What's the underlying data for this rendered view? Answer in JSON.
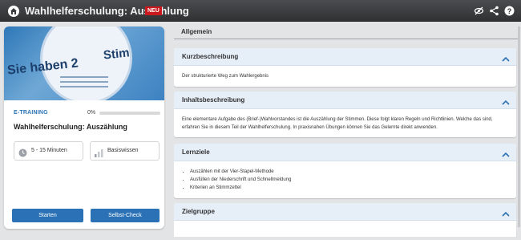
{
  "header": {
    "title": "Wahlhelferschulung: Auszählung",
    "badge": "NEU",
    "icons": [
      "home-icon",
      "eye-off-icon",
      "share-icon",
      "help-icon"
    ]
  },
  "card": {
    "hero_words": [
      "Sie haben 2",
      "Stim"
    ],
    "type_label": "E-TRAINING",
    "progress_text": "0%",
    "progress_value": 0,
    "title": "Wahlhelferschulung: Auszählung",
    "duration": "5 - 15 Minuten",
    "level": "Basiswissen",
    "start_label": "Starten",
    "selfcheck_label": "Selbst-Check"
  },
  "tabs": [
    {
      "label": "Allgemein"
    }
  ],
  "sections": [
    {
      "title": "Kurzbeschreibung",
      "body": "Der strukturierte Weg zum Wahlergebnis"
    },
    {
      "title": "Inhaltsbeschreibung",
      "body": "Eine elementare Aufgabe des (Brief-)Wahlvorstandes ist die Auszählung der Stimmen. Diese folgt klaren Regeln und Richtlinien. Welche das sind, erfahren Sie in diesem Teil der Wahlhelferschulung. In praxisnahen Übungen können Sie das Gelernte direkt anwenden."
    },
    {
      "title": "Lernziele",
      "items": [
        "Auszählen mit der Vier-Stapel-Methode",
        "Ausfüllen der Niederschrift und Schnellmeldung",
        "Kriterien an Stimmzettel"
      ]
    },
    {
      "title": "Zielgruppe"
    }
  ],
  "colors": {
    "accent": "#2a72b5",
    "badge": "#c9181e",
    "section_head": "#e6eef8"
  }
}
